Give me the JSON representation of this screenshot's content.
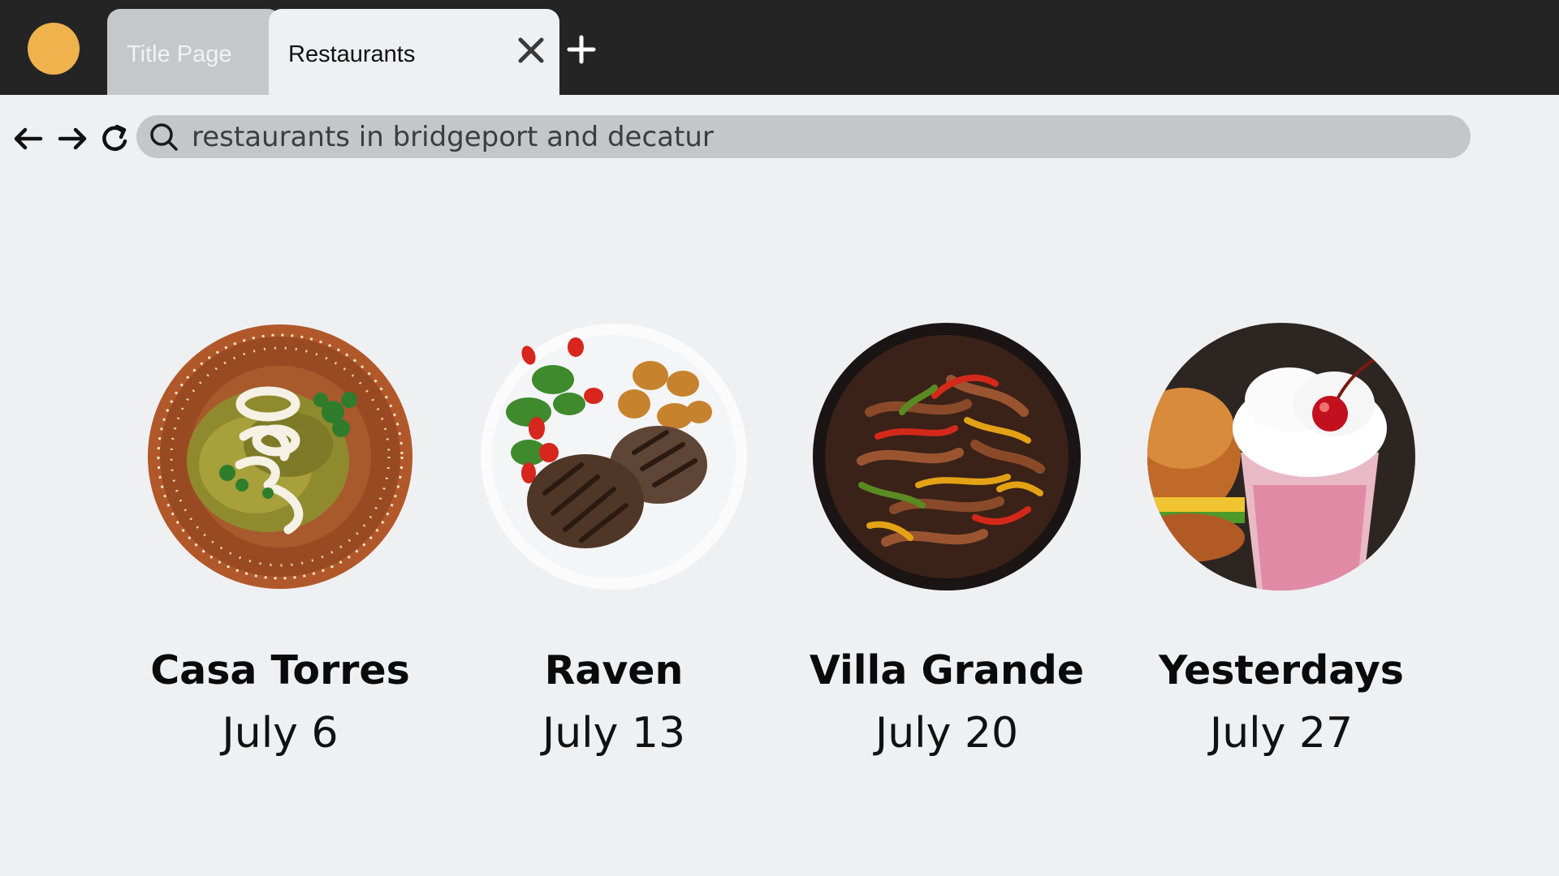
{
  "tabs": [
    {
      "label": "Title Page",
      "active": false
    },
    {
      "label": "Restaurants",
      "active": true
    }
  ],
  "icons": {
    "logo": "circle-logo-icon",
    "close": "close-icon",
    "new_tab": "plus-icon",
    "back": "arrow-left-icon",
    "forward": "arrow-right-icon",
    "reload": "reload-icon",
    "search": "search-icon"
  },
  "search": {
    "value": "restaurants in bridgeport and decatur"
  },
  "restaurants": [
    {
      "name": "Casa Torres",
      "date": "July 6",
      "photo": "enchiladas-verdes-plate-icon"
    },
    {
      "name": "Raven",
      "date": "July 13",
      "photo": "steak-salad-potatoes-plate-icon"
    },
    {
      "name": "Villa Grande",
      "date": "July 20",
      "photo": "fajitas-skillet-icon"
    },
    {
      "name": "Yesterdays",
      "date": "July 27",
      "photo": "milkshake-burger-icon"
    }
  ],
  "colors": {
    "topbar": "#242424",
    "logo": "#efb24d",
    "inactive_tab": "#c6c7c9",
    "page_bg": "#eff0f2",
    "search_bar": "#c5c6c8"
  }
}
